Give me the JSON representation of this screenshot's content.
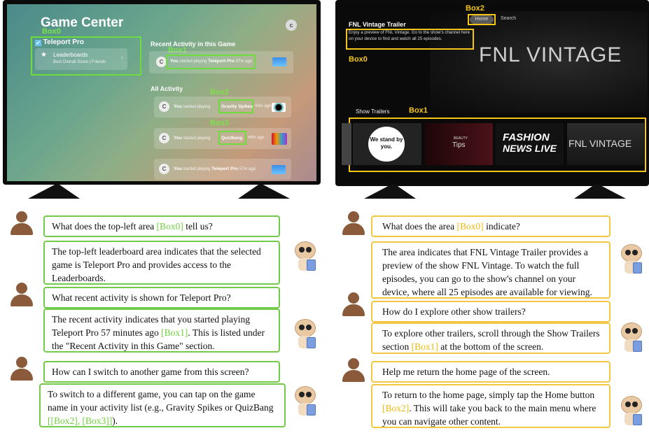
{
  "left_screen": {
    "title": "Game Center",
    "avatar": "c",
    "box0_label": "Box0",
    "game": "Teleport Pro",
    "leaderboards": "Leaderboards",
    "leaderboards_sub": "Best Overall Score | Friends",
    "recent_heading": "Recent Activity in this Game",
    "box1_label": "Box1",
    "recent_item": {
      "you": "You",
      "text": " started playing ",
      "game": "Teleport Pro",
      "time": "57m ago"
    },
    "all_heading": "All Activity",
    "box2_label": "Box2",
    "box3_label": "Box3",
    "activities": [
      {
        "you": "You",
        "text": " started playing ",
        "game": "Gravity Spikes",
        "time": "43m ago"
      },
      {
        "you": "You",
        "text": " started playing ",
        "game": "QuizBang",
        "time": "46m ago"
      },
      {
        "you": "You",
        "text": " started playing ",
        "game": "Teleport Pro",
        "time": "57m ago"
      }
    ]
  },
  "right_screen": {
    "box2_label": "Box2",
    "nav_home": "Home",
    "nav_search": "Search",
    "title": "FNL Vintage Trailer",
    "desc": "Enjoy a preview of FNL Vintage. Go to the show's channel here on your device to find and watch all 25 episodes.",
    "box0_label": "Box0",
    "logo": "FNL VINTAGE",
    "row_title": "Show Trailers",
    "box1_label": "Box1",
    "tiles": {
      "t1": "We stand by you.",
      "t2_small": "BEAUTY",
      "t2": "Tips",
      "t3a": "FASHION",
      "t3b": "NEWS LIVE",
      "t4": "FNL VINTAGE"
    }
  },
  "left_chat": [
    {
      "role": "user",
      "text": "What does the top-left area ",
      "ref": "[Box0]",
      "tail": " tell us?"
    },
    {
      "role": "bot",
      "text": "The top-left leaderboard area indicates that the selected game is Teleport Pro and provides access to the Leaderboards.",
      "ref": "",
      "tail": ""
    },
    {
      "role": "user",
      "text": "What recent activity is shown for Teleport Pro?",
      "ref": "",
      "tail": ""
    },
    {
      "role": "bot",
      "text": "The recent activity indicates that you started playing Teleport Pro 57 minutes ago ",
      "ref": "[Box1]",
      "tail": ". This is listed under the \"Recent Activity in this Game\" section."
    },
    {
      "role": "user",
      "text": "How can I switch to another game from this screen?",
      "ref": "",
      "tail": ""
    },
    {
      "role": "bot",
      "text": "To switch to a different game, you can tap on the game name in your activity list (e.g., Gravity Spikes or QuizBang ",
      "ref": "[[Box2], [Box3]]",
      "tail": ")."
    }
  ],
  "right_chat": [
    {
      "role": "user",
      "text": "What does the area ",
      "ref": "[Box0]",
      "tail": " indicate?"
    },
    {
      "role": "bot",
      "text": "The area indicates that FNL Vintage Trailer provides a preview of the show FNL Vintage. To watch the full episodes, you can go to the show's channel on your device, where all 25 episodes are available for viewing.",
      "ref": "",
      "tail": ""
    },
    {
      "role": "user",
      "text": "How do I explore other show trailers?",
      "ref": "",
      "tail": ""
    },
    {
      "role": "bot",
      "text": "To explore other trailers, scroll through the Show Trailers section ",
      "ref": "[Box1]",
      "tail": " at the bottom of the screen."
    },
    {
      "role": "user",
      "text": "Help me return the home page of the screen.",
      "ref": "",
      "tail": ""
    },
    {
      "role": "bot",
      "text": "To return to the home page, simply tap the Home button ",
      "ref": "[Box2]",
      "tail": ". This will take you back to the main menu where you can navigate other content."
    }
  ]
}
